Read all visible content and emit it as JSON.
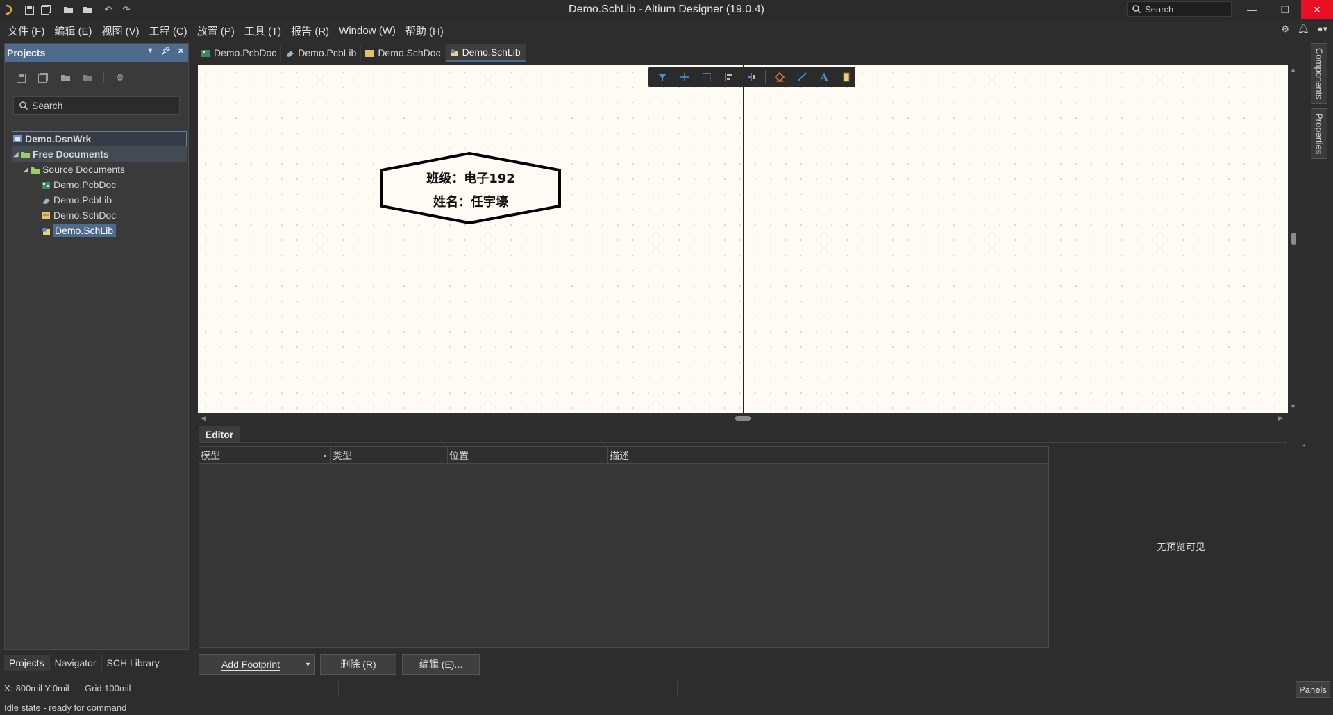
{
  "window": {
    "title": "Demo.SchLib - Altium Designer (19.0.4)",
    "search_placeholder": "Search",
    "minimize": "—",
    "restore": "❐",
    "close": "✕"
  },
  "menu": [
    "文件 (F)",
    "编辑 (E)",
    "视图 (V)",
    "工程 (C)",
    "放置 (P)",
    "工具 (T)",
    "报告 (R)",
    "Window (W)",
    "帮助 (H)"
  ],
  "projects": {
    "title": "Projects",
    "search_placeholder": "Search",
    "tree": [
      {
        "label": "Demo.DsnWrk",
        "icon": "workspace-icon"
      },
      {
        "label": "Free Documents",
        "icon": "folder-icon"
      },
      {
        "label": "Source Documents",
        "icon": "folder-icon"
      },
      {
        "label": "Demo.PcbDoc",
        "icon": "pcbdoc-icon"
      },
      {
        "label": "Demo.PcbLib",
        "icon": "pcblib-icon"
      },
      {
        "label": "Demo.SchDoc",
        "icon": "schdoc-icon"
      },
      {
        "label": "Demo.SchLib",
        "icon": "schlib-icon"
      }
    ],
    "footer_tabs": [
      "Projects",
      "Navigator",
      "SCH Library"
    ]
  },
  "doc_tabs": [
    "Demo.PcbDoc",
    "Demo.PcbLib",
    "Demo.SchDoc",
    "Demo.SchLib"
  ],
  "canvas": {
    "component_line1": "班级：电子192",
    "component_line2": "姓名：任宇壕"
  },
  "float_toolbar": [
    "filter-icon",
    "add-icon",
    "select-rect-icon",
    "align-icon",
    "move-icon",
    "eraser-icon",
    "line-icon",
    "text-icon",
    "component-icon"
  ],
  "right_tabs": [
    "Components",
    "Properties"
  ],
  "editor": {
    "tab": "Editor",
    "columns": [
      "模型",
      "类型",
      "位置",
      "描述"
    ],
    "preview": "无预览可见",
    "buttons": {
      "add": "Add Footprint",
      "delete": "删除 (R)",
      "edit": "编辑 (E)..."
    }
  },
  "status": {
    "coords": "X:-800mil Y:0mil",
    "grid": "Grid:100mil",
    "idle": "Idle state - ready for command",
    "panels": "Panels"
  },
  "colors": {
    "accent": "#4d6b8c",
    "canvas_bg": "#fdfbf3",
    "close_red": "#e81123"
  }
}
